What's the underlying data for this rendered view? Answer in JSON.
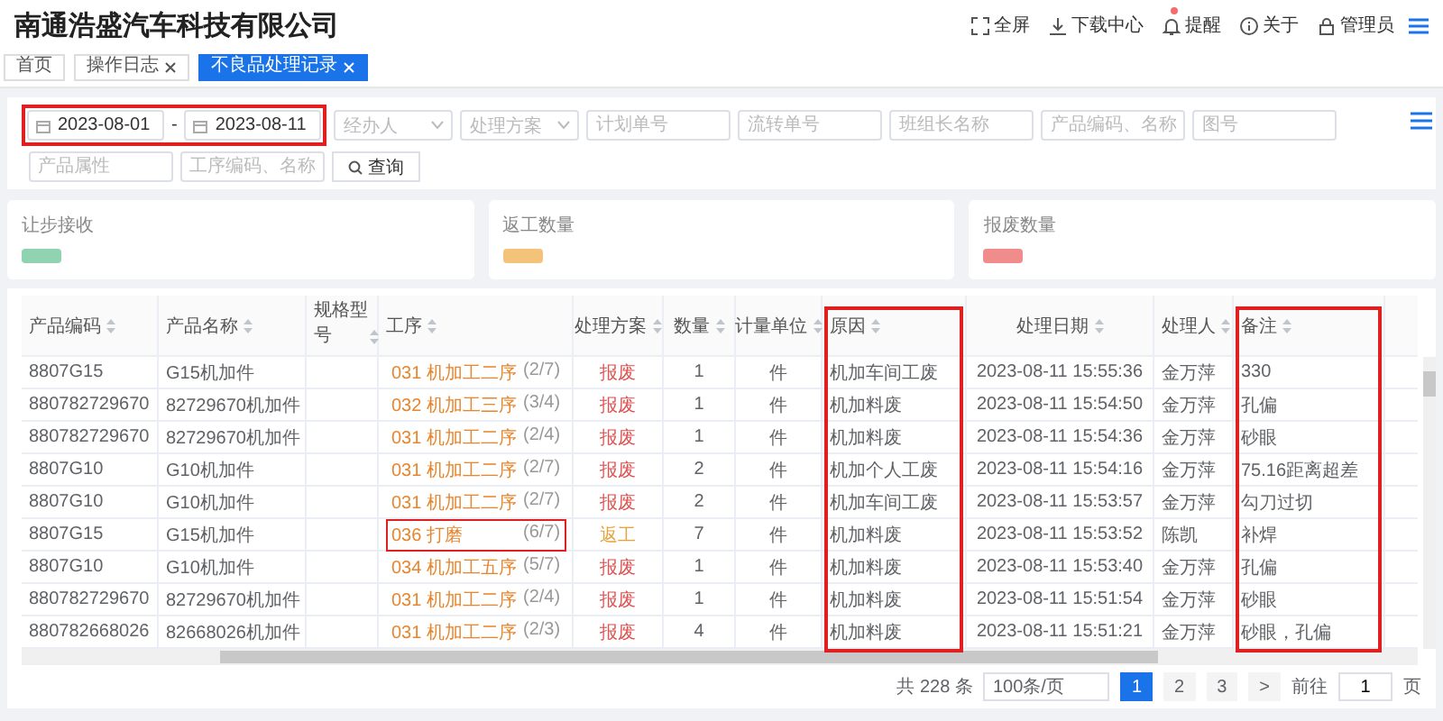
{
  "app": {
    "title": "南通浩盛汽车科技有限公司"
  },
  "toolbar": [
    {
      "kind": "fullscreen",
      "label": "全屏",
      "badge": false
    },
    {
      "kind": "download",
      "label": "下载中心",
      "badge": false
    },
    {
      "kind": "bell",
      "label": "提醒",
      "badge": true
    },
    {
      "kind": "info",
      "label": "关于",
      "badge": false
    },
    {
      "kind": "user",
      "label": "管理员",
      "badge": false
    }
  ],
  "tabs": [
    {
      "label": "首页",
      "closable": false,
      "selected": false
    },
    {
      "label": "操作日志",
      "closable": true,
      "selected": false
    },
    {
      "label": "不良品处理记录",
      "closable": true,
      "selected": true
    }
  ],
  "filters": {
    "date_range": {
      "start": "2023-08-01",
      "separator": "-",
      "end": "2023-08-11",
      "highlighted": true
    },
    "fields": [
      {
        "placeholder": "经办人",
        "kind": "select"
      },
      {
        "placeholder": "处理方案",
        "kind": "select"
      },
      {
        "placeholder": "计划单号",
        "kind": "input"
      },
      {
        "placeholder": "流转单号",
        "kind": "input"
      },
      {
        "placeholder": "班组长名称",
        "kind": "input"
      },
      {
        "placeholder": "产品编码、名称",
        "kind": "input"
      },
      {
        "placeholder": "图号",
        "kind": "input"
      }
    ],
    "fields_row2": [
      {
        "placeholder": "产品属性",
        "kind": "input"
      },
      {
        "placeholder": "工序编码、名称",
        "kind": "input"
      }
    ],
    "search_button": "查询"
  },
  "stats": [
    {
      "label": "让步接收",
      "color": "#8fd3b0"
    },
    {
      "label": "返工数量",
      "color": "#f5c27a"
    },
    {
      "label": "报废数量",
      "color": "#f08c8c"
    }
  ],
  "table": {
    "columns": [
      {
        "label": "产品编码",
        "highlighted": false
      },
      {
        "label": "产品名称",
        "highlighted": false
      },
      {
        "label": "规格型号",
        "highlighted": false
      },
      {
        "label": "工序",
        "highlighted": false
      },
      {
        "label": "处理方案",
        "highlighted": false
      },
      {
        "label": "数量",
        "highlighted": false
      },
      {
        "label": "计量单位",
        "highlighted": false
      },
      {
        "label": "原因",
        "highlighted": true
      },
      {
        "label": "处理日期",
        "highlighted": false
      },
      {
        "label": "处理人",
        "highlighted": false
      },
      {
        "label": "备注",
        "highlighted": true
      }
    ],
    "rows": [
      {
        "code": "8807G15",
        "name": "G15机加件",
        "process": "031 机加工二序",
        "step": "(2/7)",
        "process_highlighted": false,
        "plan": "报废",
        "color": "#e05050",
        "qty": "1",
        "unit": "件",
        "reason": "机加车间工废",
        "date": "2023-08-11 15:55:36",
        "handler": "金万萍",
        "remark": "330"
      },
      {
        "code": "880782729670",
        "name": "82729670机加件",
        "process": "032 机加工三序",
        "step": "(3/4)",
        "process_highlighted": false,
        "plan": "报废",
        "color": "#e05050",
        "qty": "1",
        "unit": "件",
        "reason": "机加料废",
        "date": "2023-08-11 15:54:50",
        "handler": "金万萍",
        "remark": "孔偏"
      },
      {
        "code": "880782729670",
        "name": "82729670机加件",
        "process": "031 机加工二序",
        "step": "(2/4)",
        "process_highlighted": false,
        "plan": "报废",
        "color": "#e05050",
        "qty": "1",
        "unit": "件",
        "reason": "机加料废",
        "date": "2023-08-11 15:54:36",
        "handler": "金万萍",
        "remark": "砂眼"
      },
      {
        "code": "8807G10",
        "name": "G10机加件",
        "process": "031 机加工二序",
        "step": "(2/7)",
        "process_highlighted": false,
        "plan": "报废",
        "color": "#e05050",
        "qty": "2",
        "unit": "件",
        "reason": "机加个人工废",
        "date": "2023-08-11 15:54:16",
        "handler": "金万萍",
        "remark": "75.16距离超差"
      },
      {
        "code": "8807G10",
        "name": "G10机加件",
        "process": "031 机加工二序",
        "step": "(2/7)",
        "process_highlighted": false,
        "plan": "报废",
        "color": "#e05050",
        "qty": "2",
        "unit": "件",
        "reason": "机加车间工废",
        "date": "2023-08-11 15:53:57",
        "handler": "金万萍",
        "remark": "勾刀过切"
      },
      {
        "code": "8807G15",
        "name": "G15机加件",
        "process": "036 打磨",
        "step": "(6/7)",
        "process_highlighted": true,
        "plan": "返工",
        "color": "#e6a23c",
        "qty": "7",
        "unit": "件",
        "reason": "机加料废",
        "date": "2023-08-11 15:53:52",
        "handler": "陈凯",
        "remark": "补焊"
      },
      {
        "code": "8807G10",
        "name": "G10机加件",
        "process": "034 机加工五序",
        "step": "(5/7)",
        "process_highlighted": false,
        "plan": "报废",
        "color": "#e05050",
        "qty": "1",
        "unit": "件",
        "reason": "机加料废",
        "date": "2023-08-11 15:53:40",
        "handler": "金万萍",
        "remark": "孔偏"
      },
      {
        "code": "880782729670",
        "name": "82729670机加件",
        "process": "031 机加工二序",
        "step": "(2/4)",
        "process_highlighted": false,
        "plan": "报废",
        "color": "#e05050",
        "qty": "1",
        "unit": "件",
        "reason": "机加料废",
        "date": "2023-08-11 15:51:54",
        "handler": "金万萍",
        "remark": "砂眼"
      },
      {
        "code": "880782668026",
        "name": "82668026机加件",
        "process": "031 机加工二序",
        "step": "(2/3)",
        "process_highlighted": false,
        "plan": "报废",
        "color": "#e05050",
        "qty": "4",
        "unit": "件",
        "reason": "机加料废",
        "date": "2023-08-11 15:51:21",
        "handler": "金万萍",
        "remark": "砂眼，孔偏"
      }
    ]
  },
  "pagination": {
    "total": "共 228 条",
    "page_size": "100条/页",
    "pages": [
      {
        "label": "1",
        "selected": true
      },
      {
        "label": "2",
        "selected": false
      },
      {
        "label": "3",
        "selected": false
      }
    ],
    "next": ">",
    "goto_label": "前往",
    "goto_value": "1",
    "goto_suffix": "页"
  }
}
